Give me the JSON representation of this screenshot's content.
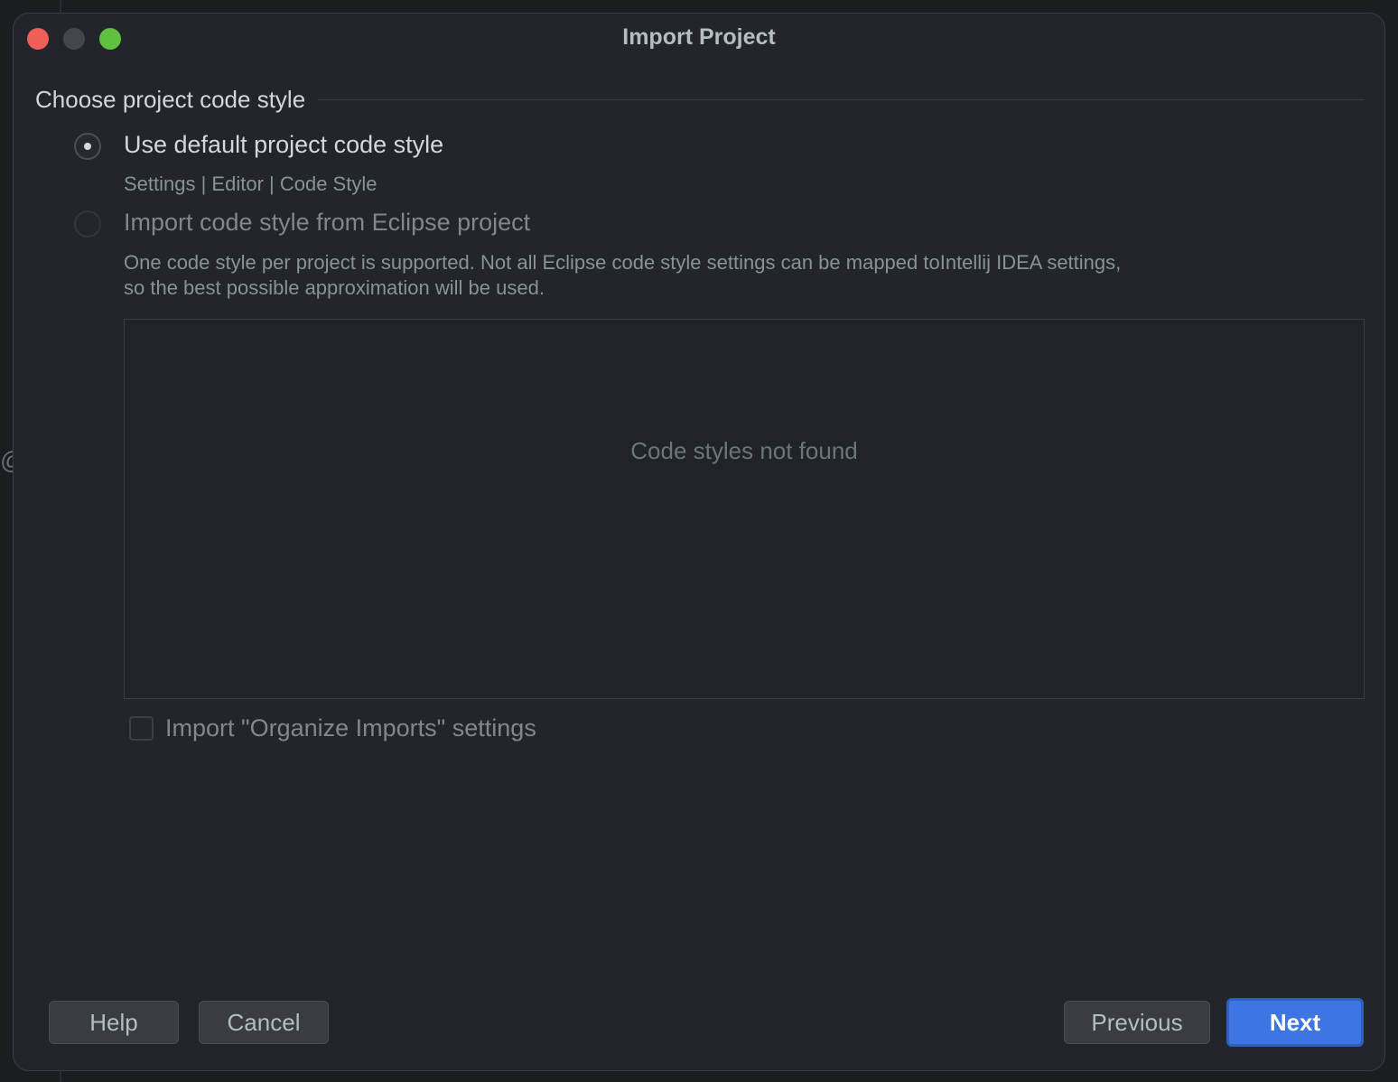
{
  "window": {
    "title": "Import Project"
  },
  "section": {
    "title": "Choose project code style"
  },
  "options": [
    {
      "label": "Use default project code style",
      "hint": "Settings | Editor | Code Style",
      "selected": true
    },
    {
      "label": "Import code style from Eclipse project",
      "description_line1": "One code style per project is supported. Not all Eclipse code style settings can be mapped toIntellij IDEA settings,",
      "description_line2": "so the best possible approximation will be used.",
      "selected": false
    }
  ],
  "code_styles_list": {
    "empty_text": "Code styles not found"
  },
  "organize_imports": {
    "label": "Import \"Organize Imports\" settings",
    "checked": false
  },
  "buttons": {
    "help": "Help",
    "cancel": "Cancel",
    "previous": "Previous",
    "next": "Next"
  },
  "colors": {
    "background": "#22252b",
    "accent": "#3d76e2",
    "traffic_close": "#ed5f57",
    "traffic_min": "#45474c",
    "traffic_max": "#5fc13d"
  },
  "backdrop": {
    "glyph": "@"
  }
}
